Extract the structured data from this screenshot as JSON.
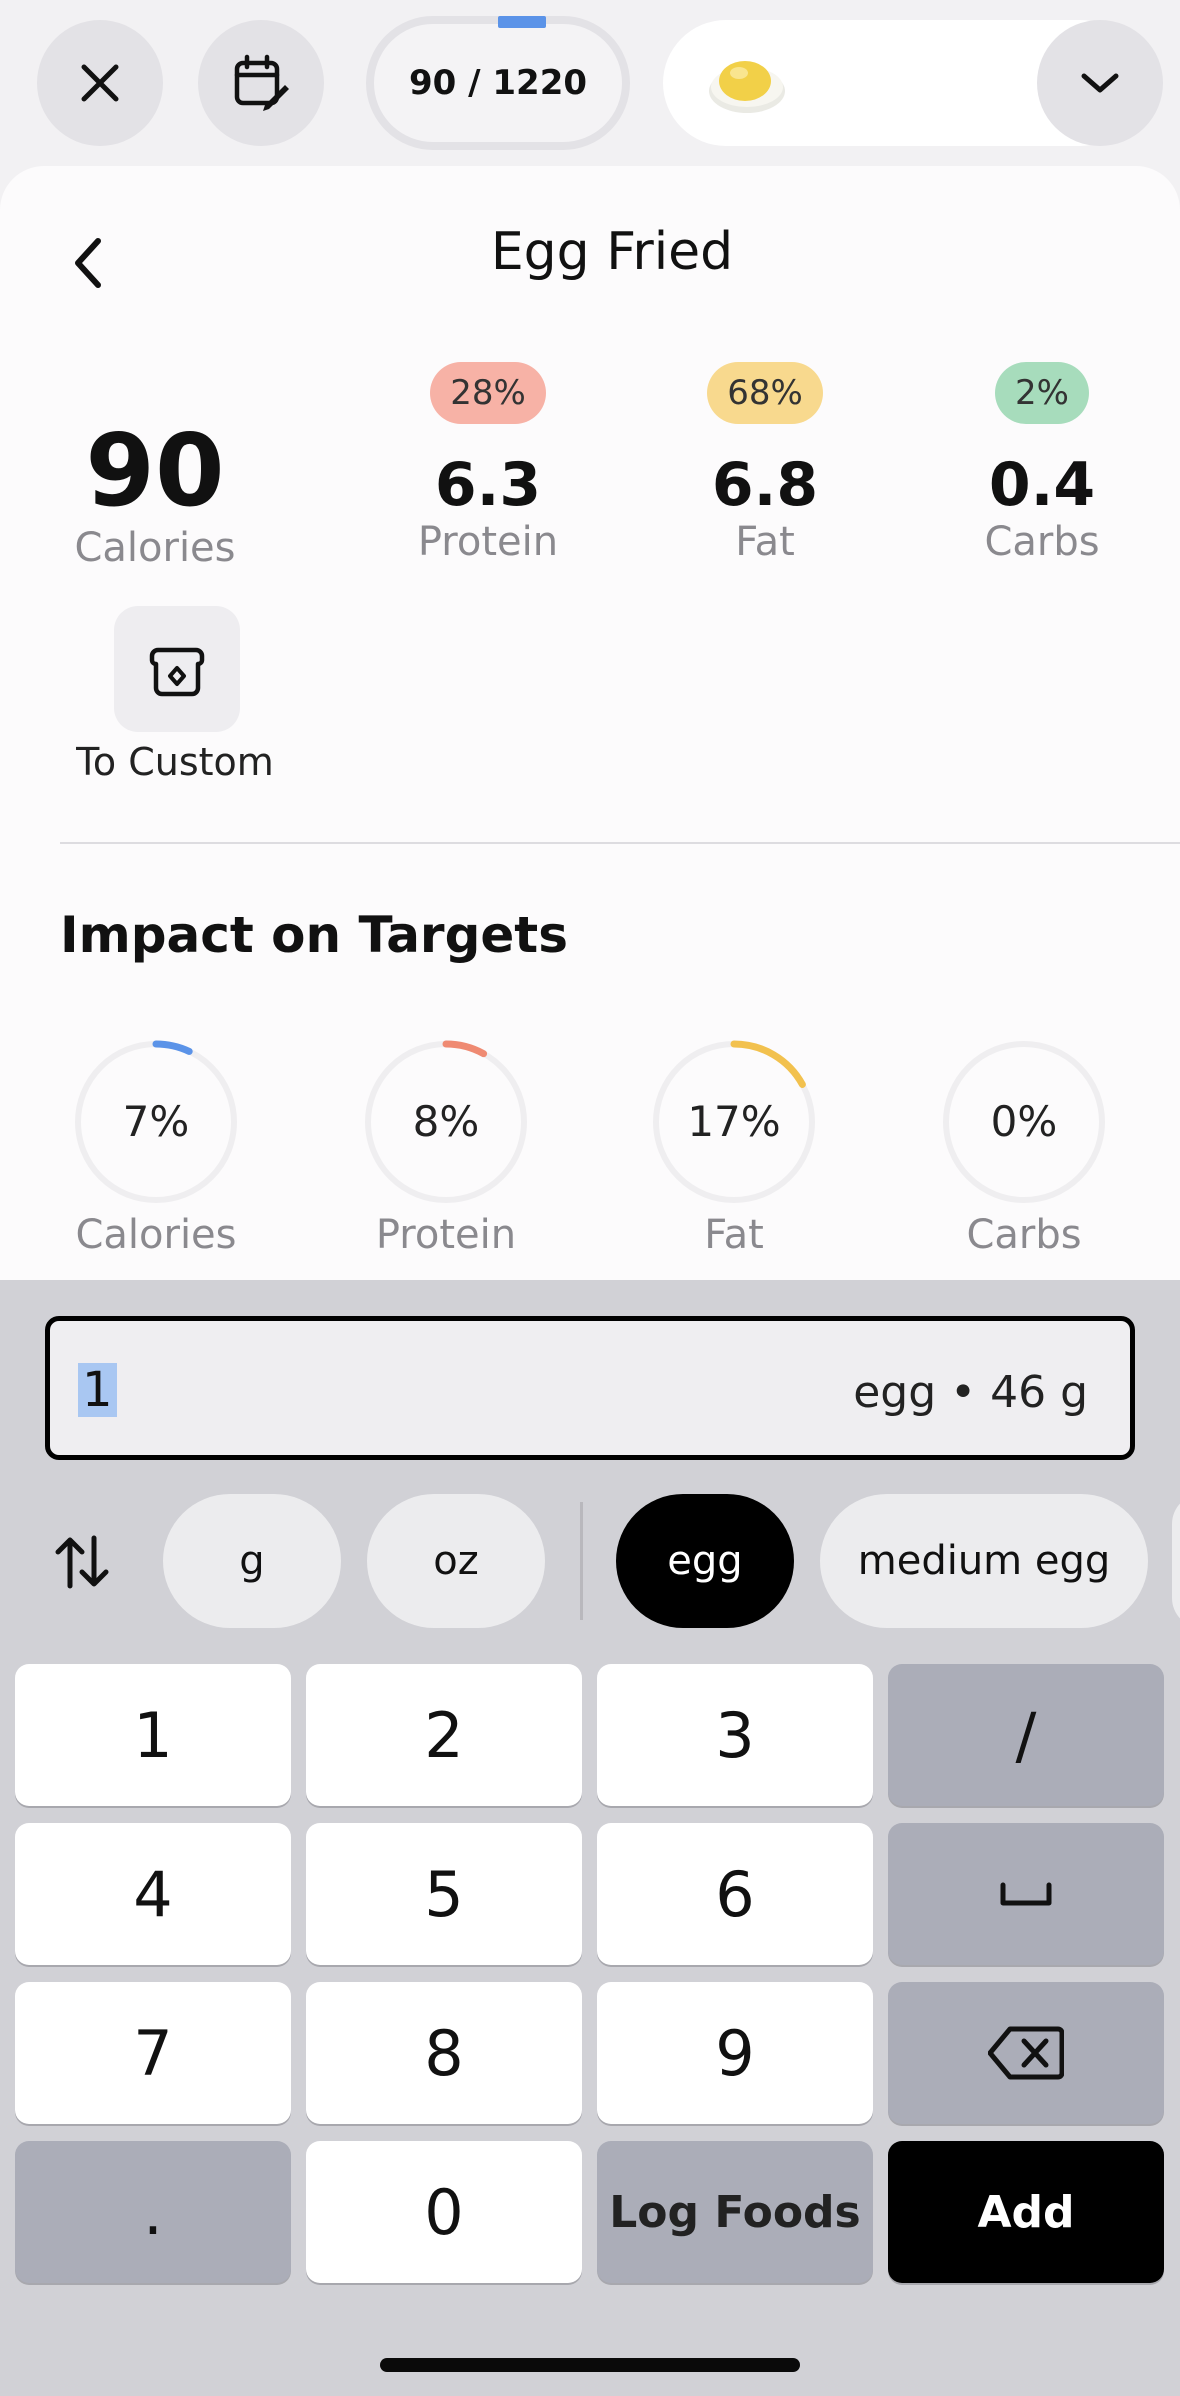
{
  "top_bar": {
    "budget_text": "90 / 1220",
    "food_icon": "fried-egg-emoji",
    "icons": [
      "close-icon",
      "calendar-edit-icon",
      "chevron-down-icon"
    ]
  },
  "sheet": {
    "title": "Egg Fried",
    "calories": {
      "value": "90",
      "label": "Calories"
    },
    "macros": [
      {
        "percent": "28%",
        "value": "6.3",
        "label": "Protein",
        "color": "#f7b2a6"
      },
      {
        "percent": "68%",
        "value": "6.8",
        "label": "Fat",
        "color": "#f8d98e"
      },
      {
        "percent": "2%",
        "value": "0.4",
        "label": "Carbs",
        "color": "#a7dcbc"
      }
    ],
    "to_custom_label": "To Custom",
    "impact": {
      "title": "Impact on Targets",
      "rings": [
        {
          "percent": "7%",
          "label": "Calories",
          "fraction": 0.07,
          "color": "#5b93e8"
        },
        {
          "percent": "8%",
          "label": "Protein",
          "fraction": 0.08,
          "color": "#ef8a72"
        },
        {
          "percent": "17%",
          "label": "Fat",
          "fraction": 0.17,
          "color": "#f2c14e"
        },
        {
          "percent": "0%",
          "label": "Carbs",
          "fraction": 0.0,
          "color": "#6cc08b"
        }
      ]
    }
  },
  "entry": {
    "quantity": "1",
    "unit_text": "egg • 46 g",
    "units": [
      "g",
      "oz",
      "egg",
      "medium egg"
    ],
    "selected_unit": "egg"
  },
  "keypad": {
    "keys": [
      "1",
      "2",
      "3",
      "/",
      "4",
      "5",
      "6",
      "␣",
      "7",
      "8",
      "9",
      ".",
      "0"
    ],
    "log_foods_label": "Log Foods",
    "add_label": "Add"
  }
}
